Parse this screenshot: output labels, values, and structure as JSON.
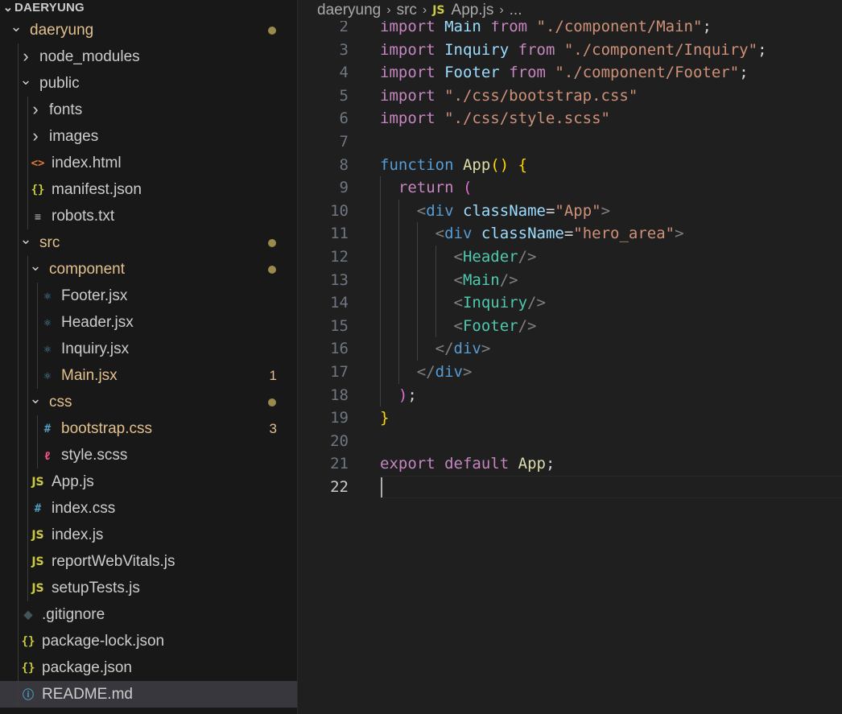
{
  "explorer": {
    "section_title": "DAERYUNG",
    "items": [
      {
        "label": "daeryung",
        "type": "folder-open",
        "depth": 0,
        "modified": true,
        "dot": true
      },
      {
        "label": "node_modules",
        "type": "folder-closed",
        "depth": 1
      },
      {
        "label": "public",
        "type": "folder-open",
        "depth": 1
      },
      {
        "label": "fonts",
        "type": "folder-closed",
        "depth": 2
      },
      {
        "label": "images",
        "type": "folder-closed",
        "depth": 2
      },
      {
        "label": "index.html",
        "type": "file",
        "icon": "html-icon",
        "glyph": "<>",
        "depth": 2
      },
      {
        "label": "manifest.json",
        "type": "file",
        "icon": "json-icon",
        "glyph": "{}",
        "depth": 2
      },
      {
        "label": "robots.txt",
        "type": "file",
        "icon": "text-file-icon",
        "glyph": "≡",
        "depth": 2
      },
      {
        "label": "src",
        "type": "folder-open",
        "depth": 1,
        "modified": true,
        "dot": true
      },
      {
        "label": "component",
        "type": "folder-open",
        "depth": 2,
        "modified": true,
        "dot": true
      },
      {
        "label": "Footer.jsx",
        "type": "file",
        "icon": "react-icon",
        "glyph": "⚛",
        "depth": 3
      },
      {
        "label": "Header.jsx",
        "type": "file",
        "icon": "react-icon",
        "glyph": "⚛",
        "depth": 3
      },
      {
        "label": "Inquiry.jsx",
        "type": "file",
        "icon": "react-icon",
        "glyph": "⚛",
        "depth": 3
      },
      {
        "label": "Main.jsx",
        "type": "file",
        "icon": "react-icon",
        "glyph": "⚛",
        "depth": 3,
        "modified": true,
        "badge": "1"
      },
      {
        "label": "css",
        "type": "folder-open",
        "depth": 2,
        "modified": true,
        "dot": true
      },
      {
        "label": "bootstrap.css",
        "type": "file",
        "icon": "css-icon",
        "glyph": "#",
        "depth": 3,
        "modified": true,
        "badge": "3"
      },
      {
        "label": "style.scss",
        "type": "file",
        "icon": "sass-icon",
        "glyph": "ℓ",
        "depth": 3
      },
      {
        "label": "App.js",
        "type": "file",
        "icon": "js-icon",
        "glyph": "JS",
        "depth": 2
      },
      {
        "label": "index.css",
        "type": "file",
        "icon": "css-icon",
        "glyph": "#",
        "depth": 2
      },
      {
        "label": "index.js",
        "type": "file",
        "icon": "js-icon",
        "glyph": "JS",
        "depth": 2
      },
      {
        "label": "reportWebVitals.js",
        "type": "file",
        "icon": "js-icon",
        "glyph": "JS",
        "depth": 2
      },
      {
        "label": "setupTests.js",
        "type": "file",
        "icon": "js-icon",
        "glyph": "JS",
        "depth": 2
      },
      {
        "label": ".gitignore",
        "type": "file",
        "icon": "git-icon",
        "glyph": "◆",
        "depth": 1
      },
      {
        "label": "package-lock.json",
        "type": "file",
        "icon": "json-icon",
        "glyph": "{}",
        "depth": 1
      },
      {
        "label": "package.json",
        "type": "file",
        "icon": "json-icon",
        "glyph": "{}",
        "depth": 1
      },
      {
        "label": "README.md",
        "type": "file",
        "icon": "info-icon",
        "glyph": "ⓘ",
        "depth": 1,
        "selected": true
      }
    ]
  },
  "breadcrumb": {
    "parts": [
      "daeryung",
      "src"
    ],
    "file_icon": "JS",
    "file": "App.js",
    "more": "..."
  },
  "editor": {
    "active_line": 22,
    "lines": [
      {
        "n": 2,
        "tokens": [
          [
            "k1",
            "import"
          ],
          [
            "pl",
            " "
          ],
          [
            "id",
            "Main"
          ],
          [
            "pl",
            " "
          ],
          [
            "k1",
            "from"
          ],
          [
            "pl",
            " "
          ],
          [
            "str",
            "\"./component/Main\""
          ],
          [
            "pl",
            ";"
          ]
        ]
      },
      {
        "n": 3,
        "tokens": [
          [
            "k1",
            "import"
          ],
          [
            "pl",
            " "
          ],
          [
            "id",
            "Inquiry"
          ],
          [
            "pl",
            " "
          ],
          [
            "k1",
            "from"
          ],
          [
            "pl",
            " "
          ],
          [
            "str",
            "\"./component/Inquiry\""
          ],
          [
            "pl",
            ";"
          ]
        ]
      },
      {
        "n": 4,
        "tokens": [
          [
            "k1",
            "import"
          ],
          [
            "pl",
            " "
          ],
          [
            "id",
            "Footer"
          ],
          [
            "pl",
            " "
          ],
          [
            "k1",
            "from"
          ],
          [
            "pl",
            " "
          ],
          [
            "str",
            "\"./component/Footer\""
          ],
          [
            "pl",
            ";"
          ]
        ]
      },
      {
        "n": 5,
        "tokens": [
          [
            "k1",
            "import"
          ],
          [
            "pl",
            " "
          ],
          [
            "str",
            "\"./css/bootstrap.css\""
          ]
        ]
      },
      {
        "n": 6,
        "tokens": [
          [
            "k1",
            "import"
          ],
          [
            "pl",
            " "
          ],
          [
            "str",
            "\"./css/style.scss\""
          ]
        ]
      },
      {
        "n": 7,
        "tokens": []
      },
      {
        "n": 8,
        "tokens": [
          [
            "k2",
            "function"
          ],
          [
            "pl",
            " "
          ],
          [
            "fn",
            "App"
          ],
          [
            "p1",
            "()"
          ],
          [
            "pl",
            " "
          ],
          [
            "p1",
            "{"
          ]
        ]
      },
      {
        "n": 9,
        "tokens": [
          [
            "pl",
            "  "
          ],
          [
            "k1",
            "return"
          ],
          [
            "pl",
            " "
          ],
          [
            "p2",
            "("
          ]
        ]
      },
      {
        "n": 10,
        "tokens": [
          [
            "pl",
            "    "
          ],
          [
            "tg",
            "<"
          ],
          [
            "tn",
            "div"
          ],
          [
            "pl",
            " "
          ],
          [
            "at",
            "className"
          ],
          [
            "pl",
            "="
          ],
          [
            "str",
            "\"App\""
          ],
          [
            "tg",
            ">"
          ]
        ]
      },
      {
        "n": 11,
        "tokens": [
          [
            "pl",
            "      "
          ],
          [
            "tg",
            "<"
          ],
          [
            "tn",
            "div"
          ],
          [
            "pl",
            " "
          ],
          [
            "at",
            "className"
          ],
          [
            "pl",
            "="
          ],
          [
            "str",
            "\"hero_area\""
          ],
          [
            "tg",
            ">"
          ]
        ]
      },
      {
        "n": 12,
        "tokens": [
          [
            "pl",
            "        "
          ],
          [
            "tg",
            "<"
          ],
          [
            "comp",
            "Header"
          ],
          [
            "tg",
            "/>"
          ]
        ]
      },
      {
        "n": 13,
        "tokens": [
          [
            "pl",
            "        "
          ],
          [
            "tg",
            "<"
          ],
          [
            "comp",
            "Main"
          ],
          [
            "tg",
            "/>"
          ]
        ]
      },
      {
        "n": 14,
        "tokens": [
          [
            "pl",
            "        "
          ],
          [
            "tg",
            "<"
          ],
          [
            "comp",
            "Inquiry"
          ],
          [
            "tg",
            "/>"
          ]
        ]
      },
      {
        "n": 15,
        "tokens": [
          [
            "pl",
            "        "
          ],
          [
            "tg",
            "<"
          ],
          [
            "comp",
            "Footer"
          ],
          [
            "tg",
            "/>"
          ]
        ]
      },
      {
        "n": 16,
        "tokens": [
          [
            "pl",
            "      "
          ],
          [
            "tg",
            "</"
          ],
          [
            "tn",
            "div"
          ],
          [
            "tg",
            ">"
          ]
        ]
      },
      {
        "n": 17,
        "tokens": [
          [
            "pl",
            "    "
          ],
          [
            "tg",
            "</"
          ],
          [
            "tn",
            "div"
          ],
          [
            "tg",
            ">"
          ]
        ]
      },
      {
        "n": 18,
        "tokens": [
          [
            "pl",
            "  "
          ],
          [
            "p2",
            ")"
          ],
          [
            "pl",
            ";"
          ]
        ]
      },
      {
        "n": 19,
        "tokens": [
          [
            "p1",
            "}"
          ]
        ]
      },
      {
        "n": 20,
        "tokens": []
      },
      {
        "n": 21,
        "tokens": [
          [
            "k1",
            "export"
          ],
          [
            "pl",
            " "
          ],
          [
            "k1",
            "default"
          ],
          [
            "pl",
            " "
          ],
          [
            "fn",
            "App"
          ],
          [
            "pl",
            ";"
          ]
        ]
      },
      {
        "n": 22,
        "tokens": []
      }
    ]
  },
  "colors": {
    "modified": "#e2c08d",
    "selected_bg": "#37373d",
    "sidebar_bg": "#181818",
    "editor_bg": "#1f1f1f"
  }
}
